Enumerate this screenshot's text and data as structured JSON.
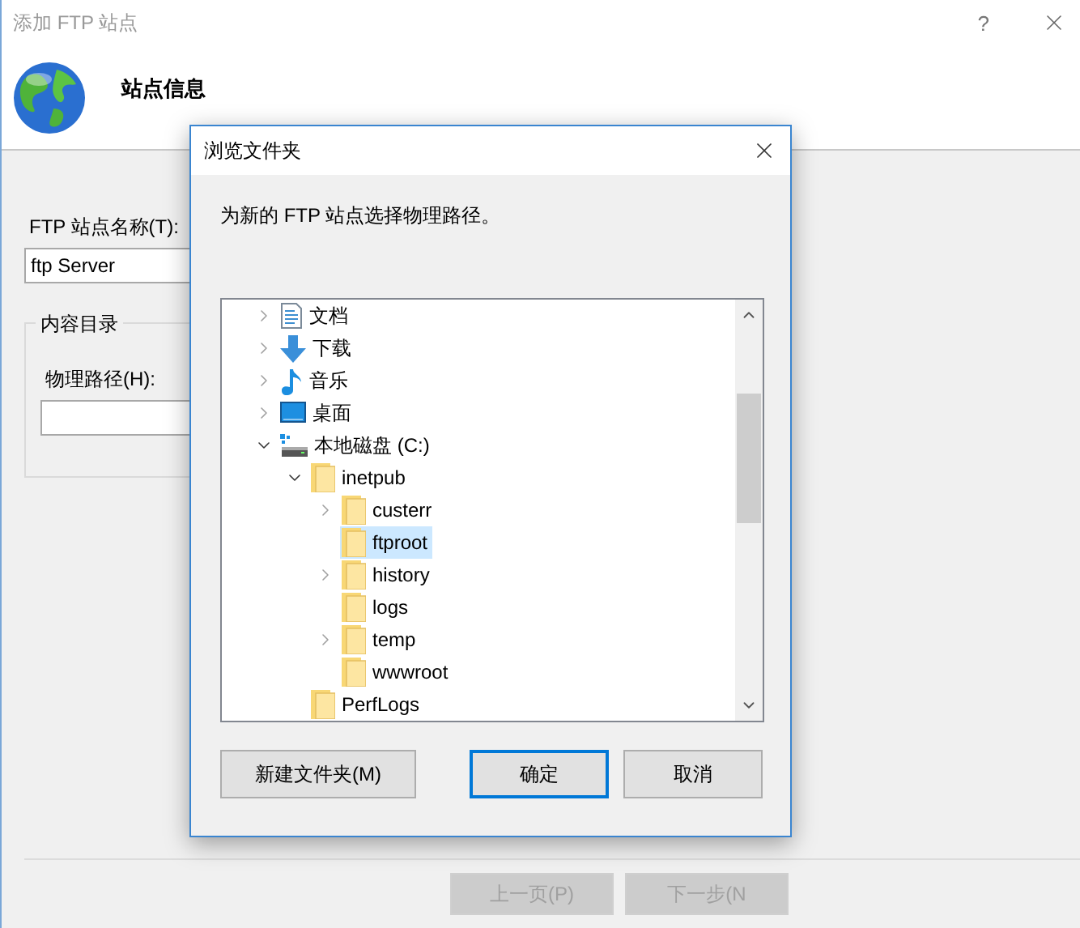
{
  "window": {
    "title": "添加 FTP 站点",
    "help": "?"
  },
  "header": {
    "title": "站点信息"
  },
  "form": {
    "site_name": {
      "label": "FTP 站点名称(T):",
      "value": "ftp Server"
    },
    "content_group": {
      "title": "内容目录",
      "path_label": "物理路径(H):"
    }
  },
  "footer_buttons": [
    {
      "label": "上一页(P)",
      "disabled": true
    },
    {
      "label": "下一步(N",
      "disabled": true
    }
  ],
  "dialog": {
    "title": "浏览文件夹",
    "prompt": "为新的 FTP 站点选择物理路径。",
    "tree": [
      {
        "label": "文档",
        "kind": "documents",
        "expandable": true,
        "expanded": false,
        "selected": false
      },
      {
        "label": "下载",
        "kind": "download",
        "expandable": true,
        "expanded": false,
        "selected": false
      },
      {
        "label": "音乐",
        "kind": "music",
        "expandable": true,
        "expanded": false,
        "selected": false
      },
      {
        "label": "桌面",
        "kind": "desktop",
        "expandable": true,
        "expanded": false,
        "selected": false
      },
      {
        "label": "本地磁盘 (C:)",
        "kind": "drive",
        "expandable": true,
        "expanded": true,
        "selected": false,
        "children": [
          {
            "label": "inetpub",
            "kind": "folder",
            "expandable": true,
            "expanded": true,
            "selected": false,
            "children": [
              {
                "label": "custerr",
                "kind": "folder",
                "expandable": true,
                "expanded": false,
                "selected": false
              },
              {
                "label": "ftproot",
                "kind": "folder",
                "expandable": false,
                "selected": true
              },
              {
                "label": "history",
                "kind": "folder",
                "expandable": true,
                "expanded": false,
                "selected": false
              },
              {
                "label": "logs",
                "kind": "folder",
                "expandable": false,
                "selected": false
              },
              {
                "label": "temp",
                "kind": "folder",
                "expandable": true,
                "expanded": false,
                "selected": false
              },
              {
                "label": "wwwroot",
                "kind": "folder",
                "expandable": false,
                "selected": false
              }
            ]
          },
          {
            "label": "PerfLogs",
            "kind": "folder",
            "expandable": false,
            "selected": false
          }
        ]
      }
    ],
    "buttons": [
      {
        "label": "新建文件夹(M)",
        "default": false
      },
      {
        "label": "确定",
        "default": true
      },
      {
        "label": "取消",
        "default": false
      }
    ]
  }
}
